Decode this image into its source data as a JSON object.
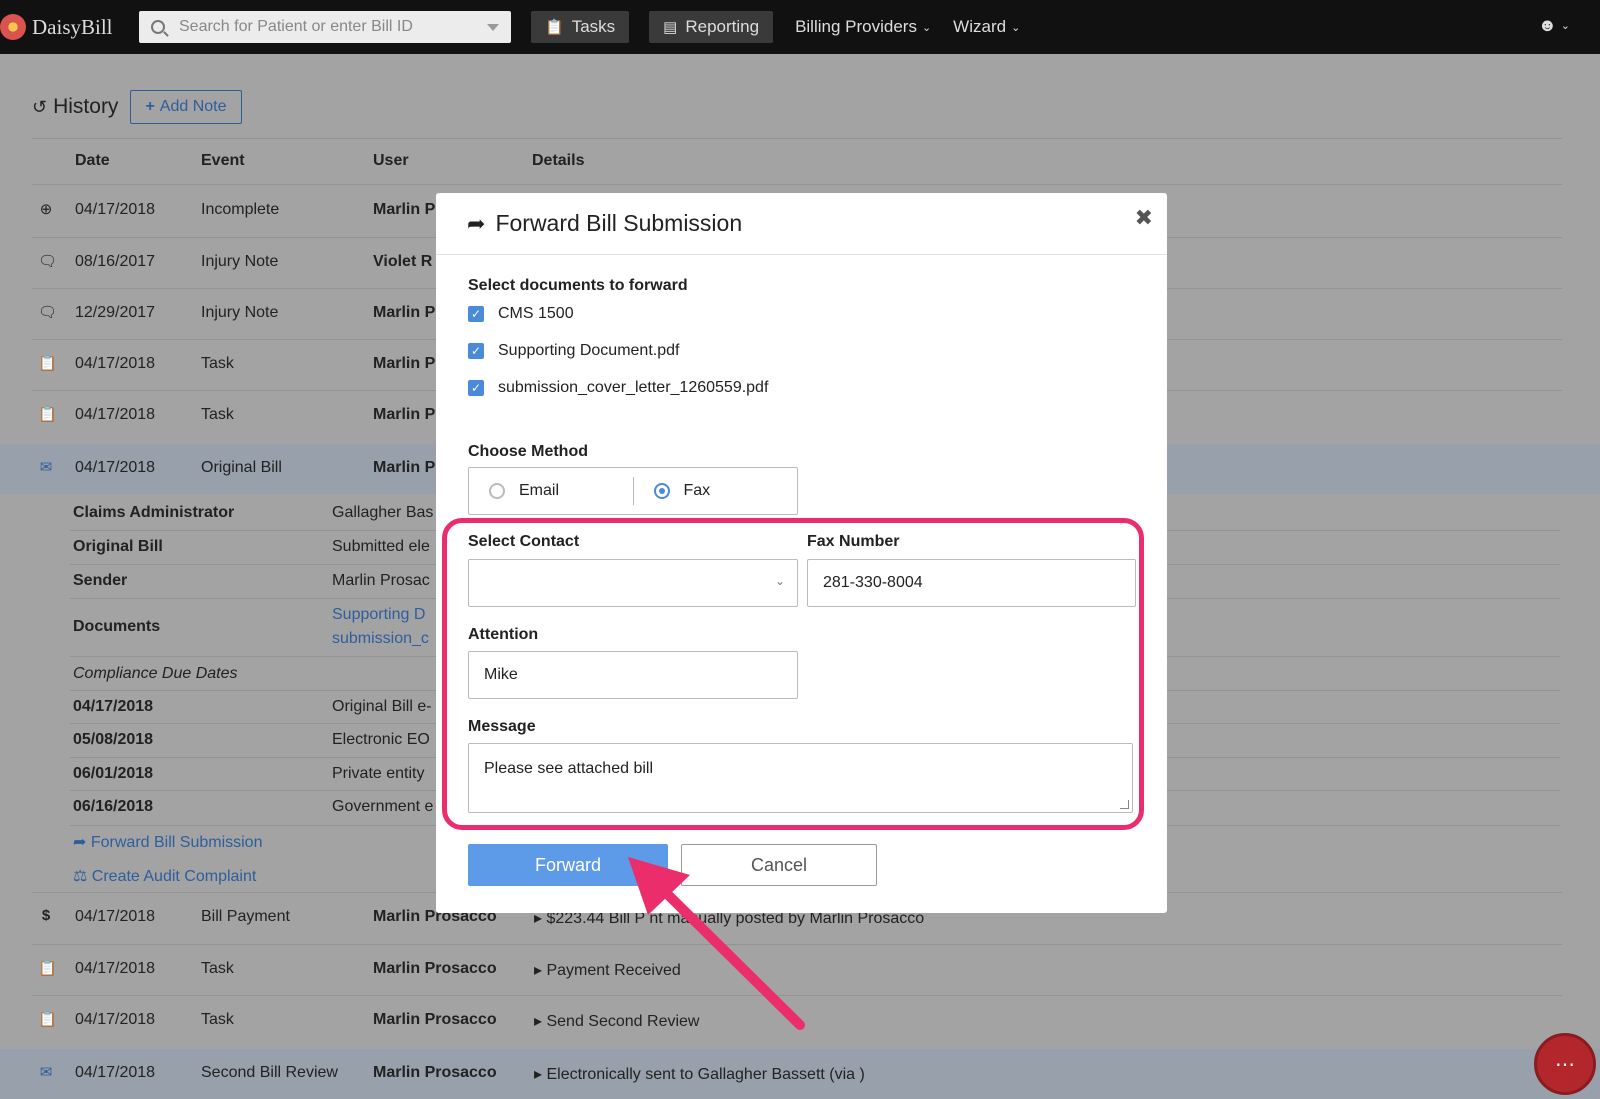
{
  "nav": {
    "brand": "DaisyBill",
    "search_placeholder": "Search for Patient or enter Bill ID",
    "tasks": "Tasks",
    "reporting": "Reporting",
    "billing_providers": "Billing Providers",
    "wizard": "Wizard"
  },
  "history": {
    "title": "History",
    "add_note": "Add Note",
    "columns": [
      "Date",
      "Event",
      "User",
      "Details"
    ],
    "rows": [
      {
        "icon": "plus-circle-icon",
        "date": "04/17/2018",
        "event": "Incomplete",
        "user": "Marlin P",
        "details": ""
      },
      {
        "icon": "comment-icon",
        "date": "08/16/2017",
        "event": "Injury Note",
        "user": "Violet R",
        "details": ""
      },
      {
        "icon": "comment-icon",
        "date": "12/29/2017",
        "event": "Injury Note",
        "user": "Marlin P",
        "details": ""
      },
      {
        "icon": "clipboard-icon",
        "date": "04/17/2018",
        "event": "Task",
        "user": "Marlin P",
        "details": ""
      },
      {
        "icon": "clipboard-icon",
        "date": "04/17/2018",
        "event": "Task",
        "user": "Marlin P",
        "details": ""
      },
      {
        "icon": "envelope-icon",
        "date": "04/17/2018",
        "event": "Original Bill",
        "user": "Marlin P",
        "details": ""
      },
      {
        "icon": "dollar-icon",
        "date": "04/17/2018",
        "event": "Bill Payment",
        "user": "Marlin Prosacco",
        "details": "$223.44 Bill P      nt manually posted by Marlin Prosacco"
      },
      {
        "icon": "clipboard-icon",
        "date": "04/17/2018",
        "event": "Task",
        "user": "Marlin Prosacco",
        "details": "Payment Received"
      },
      {
        "icon": "clipboard-icon",
        "date": "04/17/2018",
        "event": "Task",
        "user": "Marlin Prosacco",
        "details": "Send Second Review"
      },
      {
        "icon": "envelope-icon",
        "date": "04/17/2018",
        "event": "Second Bill Review",
        "user": "Marlin Prosacco",
        "details": "Electronically sent to Gallagher Bassett (via )"
      }
    ],
    "expanded": {
      "claims_admin_label": "Claims Administrator",
      "claims_admin_value": "Gallagher Bas",
      "original_bill_label": "Original Bill",
      "original_bill_value": "Submitted ele",
      "sender_label": "Sender",
      "sender_value": "Marlin Prosac",
      "documents_label": "Documents",
      "doc1": "Supporting D",
      "doc2": "submission_c",
      "compliance_label": "Compliance Due Dates",
      "due_dates": [
        {
          "date": "04/17/2018",
          "desc": "Original Bill e-"
        },
        {
          "date": "05/08/2018",
          "desc": "Electronic EO"
        },
        {
          "date": "06/01/2018",
          "desc": "Private entity"
        },
        {
          "date": "06/16/2018",
          "desc": "Government e"
        }
      ],
      "forward_link": "Forward Bill Submission",
      "audit_link": "Create Audit Complaint"
    }
  },
  "modal": {
    "title": "Forward Bill Submission",
    "select_docs_label": "Select documents to forward",
    "documents": [
      "CMS 1500",
      "Supporting Document.pdf",
      "submission_cover_letter_1260559.pdf"
    ],
    "choose_method_label": "Choose Method",
    "method_email": "Email",
    "method_fax": "Fax",
    "selected_method": "Fax",
    "select_contact_label": "Select Contact",
    "select_contact_value": "",
    "fax_number_label": "Fax Number",
    "fax_number_value": "281-330-8004",
    "attention_label": "Attention",
    "attention_value": "Mike",
    "message_label": "Message",
    "message_value": "Please see attached bill",
    "forward_button": "Forward",
    "cancel_button": "Cancel"
  },
  "colors": {
    "highlight": "#ec2d6c",
    "primary_button": "#5d9ae8",
    "link": "#2e5e9c"
  }
}
